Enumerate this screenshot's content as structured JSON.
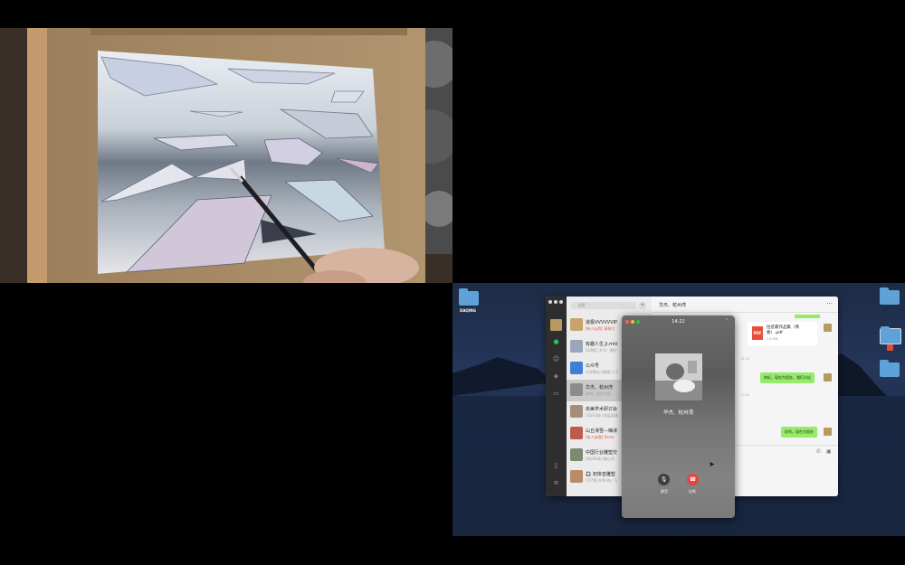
{
  "desktop": {
    "left_folder_label": "DAQING"
  },
  "wechat": {
    "search_placeholder": "搜索",
    "conversation_title": "华杰、杭州湾",
    "more_label": "···",
    "chats": [
      {
        "name": "道极VVVVVVIP",
        "sub_tag": "",
        "sub": "[有人@我] 源泉大"
      },
      {
        "name": "有趣人生.Ji.mhl",
        "sub_tag": "",
        "sub": "[3/8条] 大卡：图片"
      },
      {
        "name": "公众号",
        "sub_tag": "",
        "sub": "大学物业 [链接] 5.5"
      },
      {
        "name": "华杰、杭州湾",
        "sub_tag": "",
        "sub": "好的，现在为您..."
      },
      {
        "name": "央美学术研讨会",
        "sub_tag": "",
        "sub": "[33/33条] 抗疫英雄"
      },
      {
        "name": "山丘滑雪—嗨滑",
        "sub_tag": "",
        "sub": "[有人@我] Victor"
      },
      {
        "name": "中国行业雕塑交",
        "sub_tag": "",
        "sub": "[46/46条] 佛山号"
      },
      {
        "name": "🎧 初体音雕塑",
        "sub_tag": "",
        "sub": "[7/7条] Infinity: 飞"
      }
    ],
    "file": {
      "name": "拉近最作品集（简要）.pdf",
      "size": "3.8 MB",
      "icon_label": "PDF"
    },
    "timestamps": [
      "15:31",
      "17:02"
    ],
    "messages": [
      "你好，现在为您办，我们讨论",
      "好的，现在为您办"
    ]
  },
  "call": {
    "time": "14:22",
    "name": "华杰、杭州湾",
    "mute_label": "静音",
    "hangup_label": "挂断"
  }
}
